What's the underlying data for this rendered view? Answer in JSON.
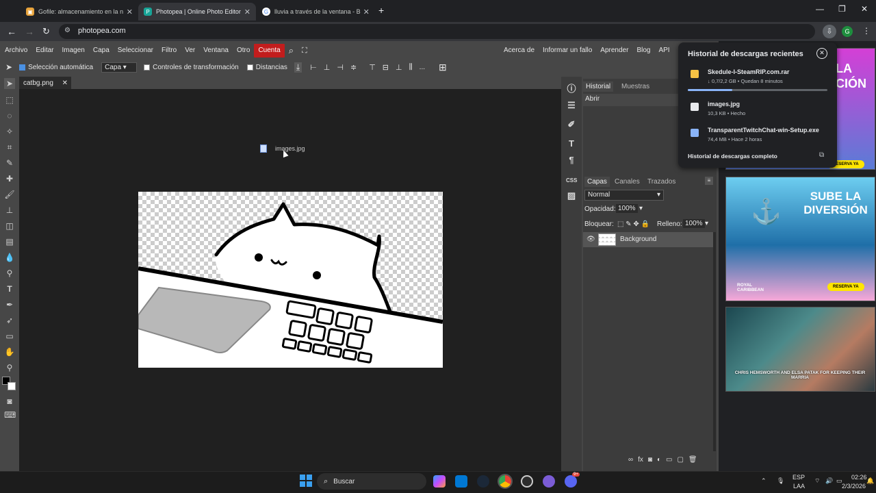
{
  "tabs": [
    {
      "title": "Gofile: almacenamiento en la n",
      "active": false,
      "icon": "gofile-icon"
    },
    {
      "title": "Photopea | Online Photo Editor",
      "active": true,
      "icon": "photopea-icon"
    },
    {
      "title": "lluvia a través de la ventana - B",
      "active": false,
      "icon": "google-icon"
    }
  ],
  "address": {
    "url": "photopea.com"
  },
  "menu": {
    "items": [
      "Archivo",
      "Editar",
      "Imagen",
      "Capa",
      "Seleccionar",
      "Filtro",
      "Ver",
      "Ventana",
      "Otro"
    ],
    "account": "Cuenta",
    "right_items": [
      "Acerca de",
      "Informar un fallo",
      "Aprender",
      "Blog",
      "API"
    ]
  },
  "options": {
    "auto_select": "Selección automática",
    "layer_select": "Capa",
    "transform_controls": "Controles de transformación",
    "distances": "Distancias",
    "more": "..."
  },
  "document": {
    "tab_name": "catbg.png",
    "dragged_file": "images.jpg"
  },
  "history_panel": {
    "tab_history": "Historial",
    "tab_samples": "Muestras",
    "entry": "Abrir"
  },
  "layers_panel": {
    "tabs": [
      "Capas",
      "Canales",
      "Trazados"
    ],
    "blend_mode": "Normal",
    "opacity_label": "Opacidad:",
    "opacity_value": "100%",
    "lock_label": "Bloquear:",
    "fill_label": "Relleno:",
    "fill_value": "100%",
    "layer_name": "Background"
  },
  "downloads": {
    "title": "Historial de descargas recientes",
    "items": [
      {
        "name": "Skedule-I-SteamRIP.com.rar",
        "status": "↓ 0,7/2,2 GB • Quedan 8 minutos",
        "progress": 0.32,
        "icon": "folder-icon"
      },
      {
        "name": "images.jpg",
        "status": "10,3 KB • Hecho",
        "icon": "image-file-icon"
      },
      {
        "name": "TransparentTwitchChat-win-Setup.exe",
        "status": "74,4 MB • Hace 2 horas",
        "icon": "installer-icon"
      }
    ],
    "footer": "Historial de descargas completo"
  },
  "ads": {
    "ad1_headline": "LA CIÓN",
    "ad1_cta": "RESERVA YA",
    "ad2_headline": "SUBE LA DIVERSIÓN",
    "ad2_brand": "ROYAL CARIBBEAN",
    "ad2_cta": "RESERVA YA",
    "ad3_caption": "CHRIS HEMSWORTH AND ELSA PATAK FOR KEEPING THEIR MARRIA"
  },
  "taskbar": {
    "search": "Buscar",
    "lang_top": "ESP",
    "lang_bottom": "LAA",
    "time": "02:26",
    "date": "2/3/2026",
    "discord_badge": "9+"
  },
  "colors": {
    "accent_red": "#c21d1d",
    "progress_blue": "#8ab4f8",
    "app_bg": "#474747"
  }
}
